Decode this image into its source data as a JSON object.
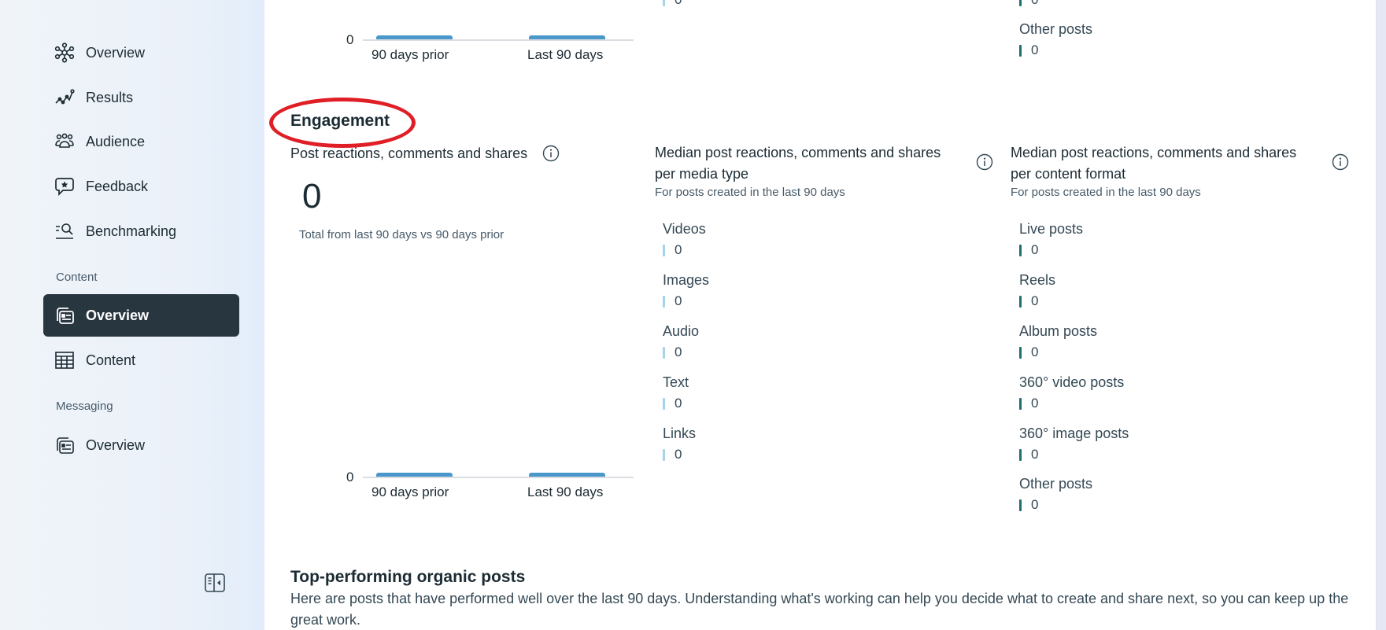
{
  "sidebar": {
    "items": [
      {
        "label": "Overview",
        "icon": "network-icon"
      },
      {
        "label": "Results",
        "icon": "trend-line-icon"
      },
      {
        "label": "Audience",
        "icon": "people-group-icon"
      },
      {
        "label": "Feedback",
        "icon": "speech-bubble-star-icon"
      },
      {
        "label": "Benchmarking",
        "icon": "list-search-icon"
      }
    ],
    "content_section": {
      "header": "Content",
      "items": [
        {
          "label": "Overview",
          "icon": "cards-stack-icon",
          "active": true
        },
        {
          "label": "Content",
          "icon": "table-grid-icon",
          "active": false
        }
      ]
    },
    "messaging_section": {
      "header": "Messaging",
      "items": [
        {
          "label": "Overview",
          "icon": "cards-stack-icon",
          "active": false
        }
      ]
    },
    "collapse_icon": "sidebar-collapse-icon"
  },
  "top_partial": {
    "chart": {
      "zero_label": "0",
      "categories": [
        "90 days prior",
        "Last 90 days"
      ],
      "values": [
        0,
        0
      ]
    },
    "media_type_last_value": "0",
    "content_format": [
      {
        "label": "Other posts",
        "value": "0"
      }
    ],
    "content_format_prev_value": "0"
  },
  "engagement": {
    "section_title": "Engagement",
    "total_card": {
      "title": "Post reactions, comments and shares",
      "value": "0",
      "note": "Total from last 90 days vs 90 days prior",
      "chart": {
        "zero_label": "0",
        "categories": [
          "90 days prior",
          "Last 90 days"
        ],
        "values": [
          0,
          0
        ]
      }
    },
    "media_type_card": {
      "title_line1": "Median post reactions, comments and shares",
      "title_line2": "per media type",
      "subtitle": "For posts created in the last 90 days",
      "bar_color": "#a7d3ea",
      "metrics": [
        {
          "label": "Videos",
          "value": "0"
        },
        {
          "label": "Images",
          "value": "0"
        },
        {
          "label": "Audio",
          "value": "0"
        },
        {
          "label": "Text",
          "value": "0"
        },
        {
          "label": "Links",
          "value": "0"
        }
      ]
    },
    "content_format_card": {
      "title_line1": "Median post reactions, comments and shares",
      "title_line2": "per content format",
      "subtitle": "For posts created in the last 90 days",
      "bar_color": "#1f6f72",
      "metrics": [
        {
          "label": "Live posts",
          "value": "0"
        },
        {
          "label": "Reels",
          "value": "0"
        },
        {
          "label": "Album posts",
          "value": "0"
        },
        {
          "label": "360° video posts",
          "value": "0"
        },
        {
          "label": "360° image posts",
          "value": "0"
        },
        {
          "label": "Other posts",
          "value": "0"
        }
      ]
    }
  },
  "top_posts": {
    "title": "Top-performing organic posts",
    "description": "Here are posts that have performed well over the last 90 days. Understanding what's working can help you decide what to create and share next, so you can keep up the great work."
  },
  "colors": {
    "bar_blue": "#4a97cc",
    "active_nav_bg": "#283640",
    "annotation_red": "#e01e26"
  }
}
